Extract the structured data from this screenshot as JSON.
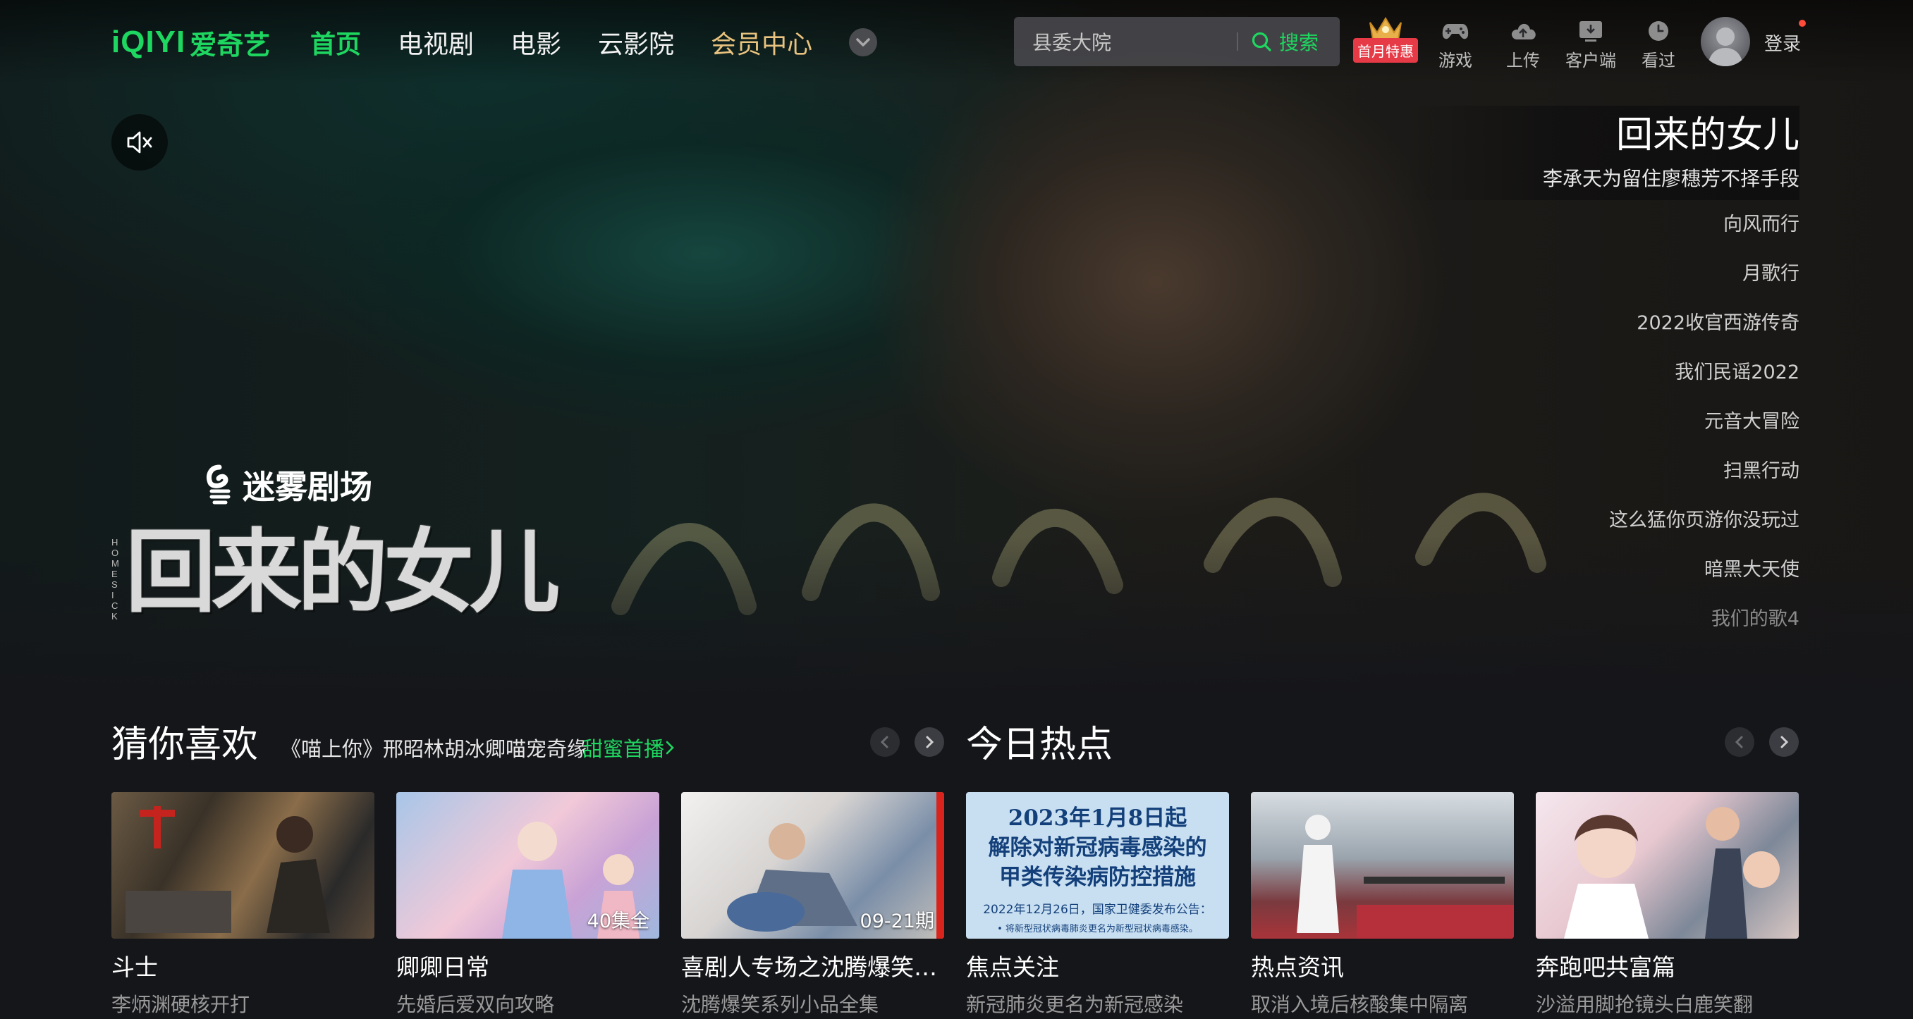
{
  "header": {
    "logo_mark": "iQIYI",
    "logo_text": "爱奇艺",
    "nav": [
      {
        "label": "首页",
        "state": "active"
      },
      {
        "label": "电视剧",
        "state": ""
      },
      {
        "label": "电影",
        "state": ""
      },
      {
        "label": "云影院",
        "state": ""
      },
      {
        "label": "会员中心",
        "state": "vip"
      }
    ],
    "search": {
      "value": "县委大院",
      "button_label": "搜索"
    },
    "vip_badge": "首月特惠",
    "tools": [
      {
        "label": "游戏",
        "icon": "gamepad-icon"
      },
      {
        "label": "上传",
        "icon": "cloud-upload-icon"
      },
      {
        "label": "客户端",
        "icon": "download-client-icon"
      },
      {
        "label": "看过",
        "icon": "history-clock-icon"
      }
    ],
    "login_label": "登录"
  },
  "hero": {
    "theater_name": "迷雾剧场",
    "show_title_art": "回来的女儿",
    "show_title_side": "HOMESICK",
    "current": {
      "title": "回来的女儿",
      "desc": "李承天为留住廖穗芳不择手段"
    },
    "list": [
      "向风而行",
      "月歌行",
      "2022收官西游传奇",
      "我们民谣2022",
      "元音大冒险",
      "扫黑行动",
      "这么猛你页游你没玩过",
      "暗黑大天使",
      "我们的歌4"
    ]
  },
  "recommend": {
    "title": "猜你喜欢",
    "subtitle": "《喵上你》邢昭林胡冰卿喵宠奇缘",
    "link": "甜蜜首播",
    "cards": [
      {
        "title": "斗士",
        "desc": "李炳渊硬核开打",
        "badge": ""
      },
      {
        "title": "卿卿日常",
        "desc": "先婚后爱双向攻略",
        "badge": "40集全"
      },
      {
        "title": "喜剧人专场之沈腾爆笑…",
        "desc": "沈腾爆笑系列小品全集",
        "badge": "09-21期"
      }
    ]
  },
  "hot": {
    "title": "今日热点",
    "cards": [
      {
        "title": "焦点关注",
        "desc": "新冠肺炎更名为新冠感染",
        "badge": ""
      },
      {
        "title": "热点资讯",
        "desc": "取消入境后核酸集中隔离",
        "badge": ""
      },
      {
        "title": "奔跑吧共富篇",
        "desc": "沙溢用脚抢镜头白鹿笑翻",
        "badge": ""
      }
    ],
    "notice": {
      "lines": [
        "2023年1月8日起",
        "解除对新冠病毒感染的",
        "甲类传染病防控措施"
      ],
      "small": "2022年12月26日，国家卫健委发布公告：",
      "bullet": "• 将新型冠状病毒肺炎更名为新型冠状病毒感染。"
    }
  },
  "colors": {
    "brand_green": "#1ed760",
    "vip_gold": "#e8c27e",
    "badge_red": "#e63a46",
    "bg": "#15161a"
  }
}
